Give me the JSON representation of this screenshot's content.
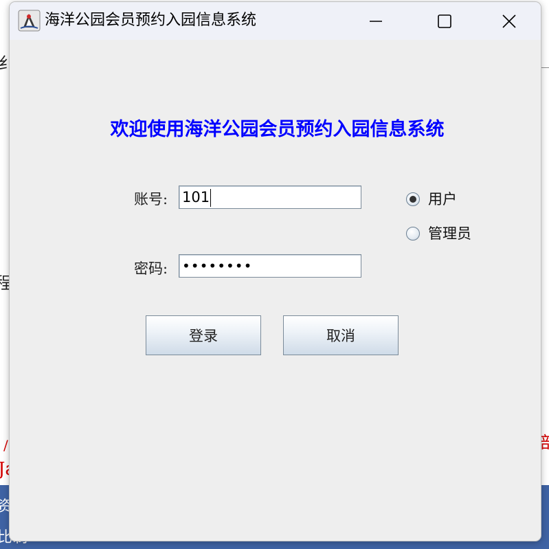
{
  "background": {
    "fragments": [
      "纟",
      "程",
      "/",
      "部",
      "Ja",
      "资",
      "比制"
    ]
  },
  "window": {
    "title": "海洋公园会员预约入园信息系统",
    "controls": [
      "minimize-icon",
      "maximize-icon",
      "close-icon"
    ]
  },
  "welcome": "欢迎使用海洋公园会员预约入园信息系统",
  "login": {
    "account_label": "账号:",
    "account_value": "101",
    "password_label": "密码:",
    "password_value": "••••••••"
  },
  "roles": [
    {
      "label": "用户",
      "checked": true
    },
    {
      "label": "管理员",
      "checked": false
    }
  ],
  "buttons": {
    "login": "登录",
    "cancel": "取消"
  },
  "colors": {
    "welcome_text": "#0000ff",
    "dialog_bg": "#eeeeee",
    "background_accent": "#3f63a4",
    "fragment_red": "#d40000"
  }
}
